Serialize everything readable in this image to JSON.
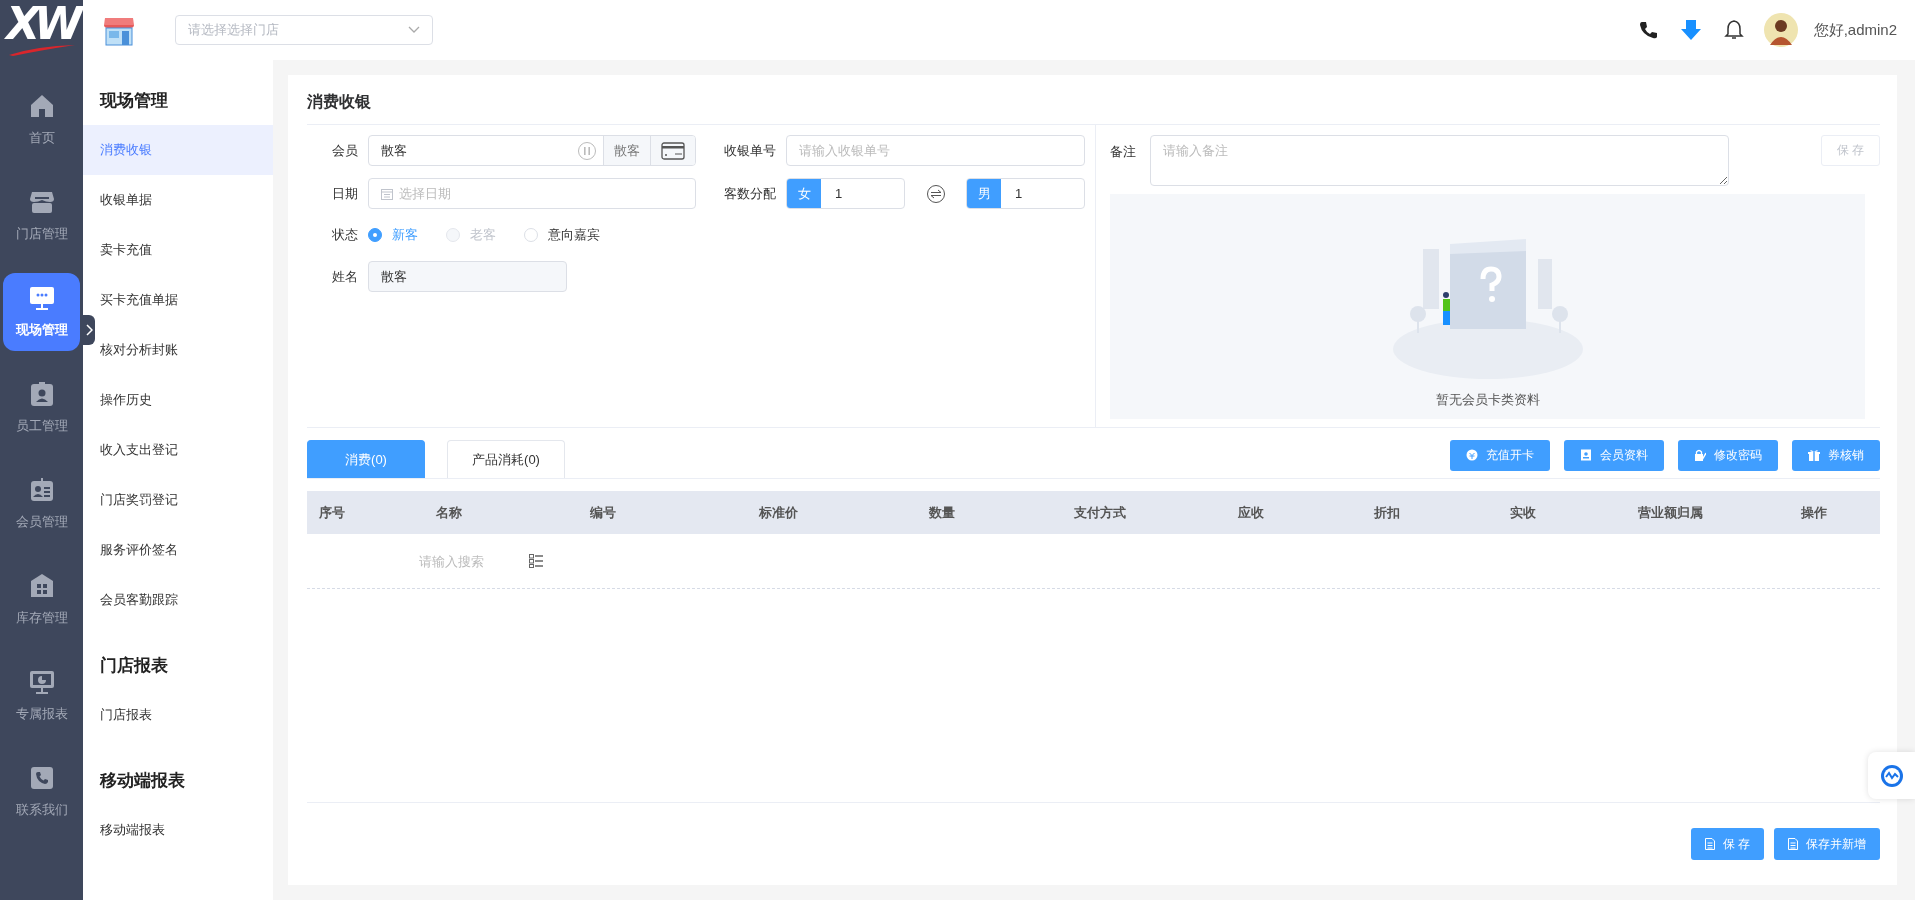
{
  "logo": {
    "text": "XW"
  },
  "rail": {
    "items": [
      {
        "label": "首页",
        "selected": false
      },
      {
        "label": "门店管理",
        "selected": false
      },
      {
        "label": "现场管理",
        "selected": true
      },
      {
        "label": "员工管理",
        "selected": false
      },
      {
        "label": "会员管理",
        "selected": false
      },
      {
        "label": "库存管理",
        "selected": false
      },
      {
        "label": "专属报表",
        "selected": false
      },
      {
        "label": "联系我们",
        "selected": false
      }
    ]
  },
  "topbar": {
    "store_select": {
      "placeholder": "请选择选择门店"
    },
    "greeting": "您好,admin2"
  },
  "submenu": {
    "groups": [
      {
        "title": "现场管理",
        "items": [
          {
            "label": "消费收银",
            "selected": true
          },
          {
            "label": "收银单据",
            "selected": false
          },
          {
            "label": "卖卡充值",
            "selected": false
          },
          {
            "label": "买卡充值单据",
            "selected": false
          },
          {
            "label": "核对分析封账",
            "selected": false
          },
          {
            "label": "操作历史",
            "selected": false
          },
          {
            "label": "收入支出登记",
            "selected": false
          },
          {
            "label": "门店奖罚登记",
            "selected": false
          },
          {
            "label": "服务评价签名",
            "selected": false
          },
          {
            "label": "会员客勤跟踪",
            "selected": false
          }
        ]
      },
      {
        "title": "门店报表",
        "items": [
          {
            "label": "门店报表",
            "selected": false
          }
        ]
      },
      {
        "title": "移动端报表",
        "items": [
          {
            "label": "移动端报表",
            "selected": false
          }
        ]
      }
    ]
  },
  "page": {
    "title": "消费收银"
  },
  "form": {
    "member": {
      "label": "会员",
      "value": "散客",
      "addon": "散客"
    },
    "receipt": {
      "label": "收银单号",
      "placeholder": "请输入收银单号"
    },
    "date": {
      "label": "日期",
      "placeholder": "选择日期"
    },
    "guests": {
      "label": "客数分配",
      "female": {
        "label": "女",
        "value": "1"
      },
      "male": {
        "label": "男",
        "value": "1"
      }
    },
    "status": {
      "label": "状态",
      "options": [
        {
          "label": "新客",
          "selected": true,
          "disabled": false
        },
        {
          "label": "老客",
          "selected": false,
          "disabled": true
        },
        {
          "label": "意向嘉宾",
          "selected": false,
          "disabled": false
        }
      ]
    },
    "name": {
      "label": "姓名",
      "value": "散客"
    }
  },
  "remark": {
    "label": "备注",
    "placeholder": "请输入备注",
    "save_button": {
      "label": "保 存",
      "disabled": true
    }
  },
  "empty_state": {
    "text": "暂无会员卡类资料"
  },
  "tabs": [
    {
      "label": "消费(0)",
      "selected": true
    },
    {
      "label": "产品消耗(0)",
      "selected": false
    }
  ],
  "actions": [
    {
      "label": "充值开卡"
    },
    {
      "label": "会员资料"
    },
    {
      "label": "修改密码"
    },
    {
      "label": "券核销"
    }
  ],
  "table": {
    "columns": [
      "序号",
      "名称",
      "编号",
      "标准价",
      "数量",
      "支付方式",
      "应收",
      "折扣",
      "实收",
      "营业额归属",
      "操作"
    ],
    "search": {
      "placeholder": "请输入搜索"
    }
  },
  "footer_buttons": [
    {
      "label": "保 存"
    },
    {
      "label": "保存并新增"
    }
  ]
}
